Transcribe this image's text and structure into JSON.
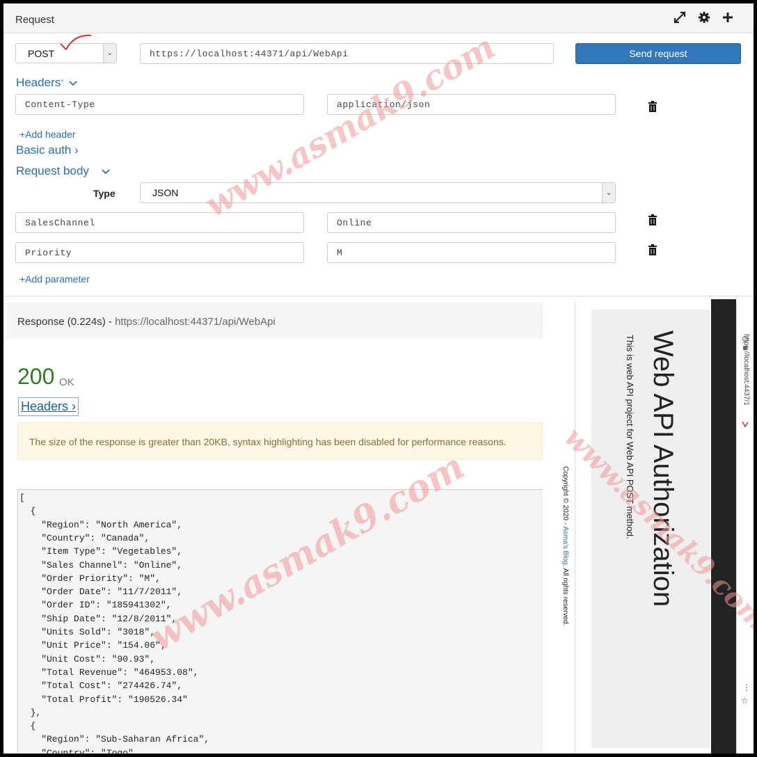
{
  "request": {
    "title": "Request",
    "icons": [
      "expand-icon",
      "gear-icon",
      "plus-icon"
    ],
    "method": "POST",
    "url": "https://localhost:44371/api/WebApi",
    "send_label": "Send request",
    "headers_label": "Headers",
    "headers": [
      {
        "name": "Content-Type",
        "value": "application/json"
      }
    ],
    "add_header_label": "+Add header",
    "basic_auth_label": "Basic auth",
    "body_label": "Request body",
    "type_label": "Type",
    "type_value": "JSON",
    "params": [
      {
        "name": "SalesChannel",
        "value": "Online"
      },
      {
        "name": "Priority",
        "value": "M"
      }
    ],
    "add_param_label": "+Add parameter"
  },
  "response": {
    "title_prefix": "Response (0.224s) - ",
    "url": "https://localhost:44371/api/WebApi",
    "status_code": "200",
    "status_text": "OK",
    "headers_label": "Headers",
    "warning": "The size of the response is greater than 20KB, syntax highlighting has been disabled for performance reasons.",
    "body_lines": [
      "[",
      "  {",
      "    \"Region\": \"North America\",",
      "    \"Country\": \"Canada\",",
      "    \"Item Type\": \"Vegetables\",",
      "    \"Sales Channel\": \"Online\",",
      "    \"Order Priority\": \"M\",",
      "    \"Order Date\": \"11/7/2011\",",
      "    \"Order ID\": \"185941302\",",
      "    \"Ship Date\": \"12/8/2011\",",
      "    \"Units Sold\": \"3018\",",
      "    \"Unit Price\": \"154.06\",",
      "    \"Unit Cost\": \"90.93\",",
      "    \"Total Revenue\": \"464953.08\",",
      "    \"Total Cost\": \"274426.74\",",
      "    \"Total Profit\": \"190526.34\"",
      "  },",
      "  {",
      "    \"Region\": \"Sub-Saharan Africa\",",
      "    \"Country\": \"Togo\","
    ]
  },
  "side_page": {
    "heading": "Web API Authorization",
    "subtext": "This is web API project for Web API POST method.",
    "copyright_prefix": "Copyright © 2020 - ",
    "copyright_link": "Asma's Blog",
    "copyright_suffix": ". All rights reserved.",
    "address": "https://localhost:4437/1"
  },
  "watermark": "www.asmak9.com"
}
